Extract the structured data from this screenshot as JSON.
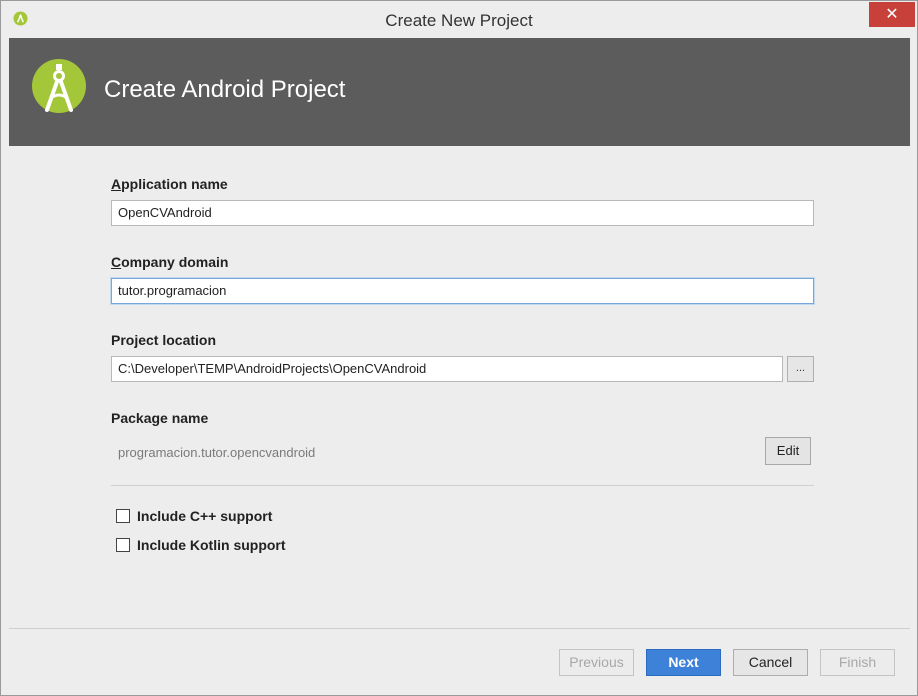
{
  "window": {
    "title": "Create New Project",
    "close_glyph": "✕"
  },
  "banner": {
    "heading": "Create Android Project",
    "logo_icon": "android-studio-logo-icon"
  },
  "form": {
    "app_name": {
      "label_first": "A",
      "label_rest": "pplication name",
      "value": "OpenCVAndroid"
    },
    "company_domain": {
      "label_first": "C",
      "label_rest": "ompany domain",
      "value": "tutor.programacion"
    },
    "project_location": {
      "label": "Project location",
      "value": "C:\\Developer\\TEMP\\AndroidProjects\\OpenCVAndroid",
      "browse_label": "..."
    },
    "package_name": {
      "label": "Package name",
      "value": "programacion.tutor.opencvandroid",
      "edit_label": "Edit"
    },
    "cpp_support": {
      "label": "Include C++ support",
      "checked": false
    },
    "kotlin_support": {
      "label": "Include Kotlin support",
      "checked": false
    }
  },
  "footer": {
    "previous_label": "Previous",
    "next_label": "Next",
    "cancel_label": "Cancel",
    "finish_label": "Finish"
  },
  "colors": {
    "banner_bg": "#5c5c5c",
    "android_green": "#a4c639",
    "primary_button": "#3e81d8",
    "close_button": "#c7403a"
  }
}
